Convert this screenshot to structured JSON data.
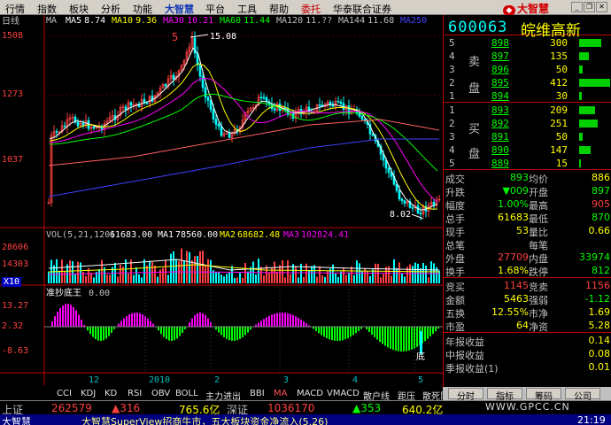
{
  "menu": {
    "items": [
      "行情",
      "指数",
      "板块",
      "分析",
      "功能",
      "大智慧",
      "平台",
      "工具",
      "帮助",
      "委托",
      "华泰联合证券"
    ],
    "logo": "大智慧"
  },
  "chart": {
    "period_label": "日线",
    "ma_legend": [
      {
        "label": "MA",
        "value": "",
        "color": "#c0c0c0"
      },
      {
        "label": "MA5",
        "value": "8.74",
        "color": "#ffffff"
      },
      {
        "label": "MA10",
        "value": "9.36",
        "color": "#ffff00"
      },
      {
        "label": "MA30",
        "value": "10.21",
        "color": "#ff00ff"
      },
      {
        "label": "MA60",
        "value": "11.44",
        "color": "#00ff00"
      },
      {
        "label": "MA120",
        "value": "11.??",
        "color": "#c0c0c0"
      },
      {
        "label": "MA144",
        "value": "11.68",
        "color": "#c0c0c0"
      },
      {
        "label": "MA250",
        "value": "",
        "color": "#4040ff"
      }
    ],
    "price_axis": [
      "1508",
      "1273",
      "1037"
    ],
    "high_label": "15.08",
    "low_label": "8.02",
    "wave_label": "5",
    "vol_legend": {
      "name": "VOL(5,21,120)",
      "v1": "61683.00",
      "ma1_label": "MA1",
      "ma1": "78560.00",
      "ma2_label": "MA2",
      "ma2": "68682.48",
      "ma3_label": "MA3",
      "ma3": "102824.41"
    },
    "vol_axis": [
      "28606",
      "14303"
    ],
    "unit_label": "X10",
    "ind_name": "准抄底王",
    "ind_value": "0.00",
    "ind_axis": [
      "13.27",
      "2.32",
      "-8.63"
    ],
    "bottom_mark": "底",
    "time_axis": [
      "12",
      "2010",
      "2",
      "3",
      "4",
      "5"
    ]
  },
  "tabs": [
    "CCI",
    "KDJ",
    "KD",
    "RSI",
    "OBV",
    "BOLL",
    "主力进出",
    "BBI",
    "MA",
    "MACD",
    "VMACD",
    "散户线",
    "距压",
    "散死队"
  ],
  "active_tab": "MA",
  "panel": {
    "code": "600063",
    "name": "皖维高新",
    "asks": [
      {
        "lvl": "5",
        "price": "898",
        "vol": "300",
        "bar": 0.72
      },
      {
        "lvl": "4",
        "price": "897",
        "vol": "135",
        "bar": 0.32
      },
      {
        "lvl": "3",
        "price": "896",
        "vol": "50",
        "bar": 0.12
      },
      {
        "lvl": "2",
        "price": "895",
        "vol": "412",
        "bar": 1.0
      },
      {
        "lvl": "1",
        "price": "894",
        "vol": "30",
        "bar": 0.08
      }
    ],
    "bids": [
      {
        "lvl": "1",
        "price": "893",
        "vol": "209",
        "bar": 0.5
      },
      {
        "lvl": "2",
        "price": "892",
        "vol": "251",
        "bar": 0.6
      },
      {
        "lvl": "3",
        "price": "891",
        "vol": "50",
        "bar": 0.12
      },
      {
        "lvl": "4",
        "price": "890",
        "vol": "147",
        "bar": 0.36
      },
      {
        "lvl": "5",
        "price": "889",
        "vol": "15",
        "bar": 0.04
      }
    ],
    "sell_label": [
      "卖",
      "盘"
    ],
    "buy_label": [
      "买",
      "盘"
    ],
    "quote": [
      {
        "l1": "成交",
        "v1": "893",
        "c1": "#00ff00",
        "l2": "均价",
        "v2": "886",
        "c2": "#ffff00"
      },
      {
        "l1": "升跌",
        "v1": "▼009",
        "c1": "#00ff00",
        "l2": "开盘",
        "v2": "897",
        "c2": "#00ff00"
      },
      {
        "l1": "幅度",
        "v1": "1.00%",
        "c1": "#00ff00",
        "l2": "最高",
        "v2": "905",
        "c2": "#ff4040"
      },
      {
        "l1": "总手",
        "v1": "61683",
        "c1": "#ffff00",
        "l2": "最低",
        "v2": "870",
        "c2": "#00ff00"
      },
      {
        "l1": "现手",
        "v1": "53",
        "c1": "#ffff00",
        "l2": "量比",
        "v2": "0.66",
        "c2": "#ffff00"
      },
      {
        "l1": "总笔",
        "v1": "",
        "c1": "#ffff00",
        "l2": "每笔",
        "v2": "",
        "c2": "#ffff00"
      },
      {
        "l1": "外盘",
        "v1": "27709",
        "c1": "#ff4040",
        "l2": "内盘",
        "v2": "33974",
        "c2": "#00ff00"
      },
      {
        "l1": "换手",
        "v1": "1.68%",
        "c1": "#ffff00",
        "l2": "跌停",
        "v2": "812",
        "c2": "#00ff00"
      }
    ],
    "fin": [
      {
        "l1": "竞买",
        "v1": "1145",
        "c1": "#ff4040",
        "l2": "竞卖",
        "v2": "1156",
        "c2": "#ff4040"
      },
      {
        "l1": "金额",
        "v1": "5463",
        "c1": "#ffff00",
        "l2": "强弱",
        "v2": "-1.12",
        "c2": "#00ff00"
      },
      {
        "l1": "五换",
        "v1": "12.55%",
        "c1": "#ffff00",
        "l2": "市净",
        "v2": "1.69",
        "c2": "#ffff00"
      },
      {
        "l1": "市盈",
        "v1": "64",
        "c1": "#ffff00",
        "l2": "净资",
        "v2": "5.28",
        "c2": "#ffff00"
      }
    ],
    "earnings": [
      {
        "l": "年报收益",
        "v": "0.14"
      },
      {
        "l": "中报收益",
        "v": "0.08"
      },
      {
        "l": "季报收益(1)",
        "v": "0.01"
      }
    ],
    "bottom_tabs": [
      "分时",
      "指标",
      "筹码",
      "公司"
    ]
  },
  "status": {
    "sh_label": "上证",
    "sh_index": "262579",
    "sh_change": "▲316",
    "sh_amount": "765.6亿",
    "sz_label": "深证",
    "sz_index": "1036170",
    "sz_change": "▲353",
    "sz_amount": "640.2亿"
  },
  "ticker": {
    "left": "大智慧",
    "text": "大智慧SuperView招商牛市，五大板块资金净流入(5.26)",
    "time": "21:19"
  },
  "watermark": "WWW.GPCC.CN"
}
